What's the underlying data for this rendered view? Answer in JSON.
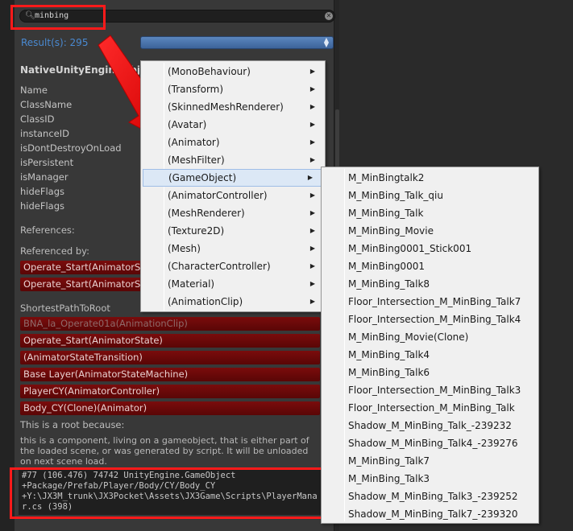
{
  "search": {
    "query": "minbing",
    "icon": "search-icon",
    "clear_icon": "clear-icon"
  },
  "results": {
    "label": "Result(s): 295"
  },
  "object": {
    "title": "NativeUnityEngineObje",
    "fields": [
      "Name",
      "ClassName",
      "ClassID",
      "instanceID",
      "isDontDestroyOnLoad",
      "isPersistent",
      "isManager",
      "hideFlags",
      "hideFlags"
    ]
  },
  "references": {
    "label": "References:"
  },
  "referenced_by": {
    "label": "Referenced by:",
    "rows": [
      "Operate_Start(AnimatorSt",
      "Operate_Start(AnimatorSt"
    ]
  },
  "shortest_path": {
    "label": "ShortestPathToRoot",
    "rows": [
      "BNA_la_Operate01a(AnimationClip)",
      "Operate_Start(AnimatorState)",
      "(AnimatorStateTransition)",
      "Base Layer(AnimatorStateMachine)",
      "PlayerCY(AnimatorController)",
      "Body_CY(Clone)(Animator)"
    ]
  },
  "root": {
    "label": "This is a root because:",
    "line1": "this is a component, living on a gameobject, that is either part of",
    "line2": "the loaded scene, or was generated by script. It will be unloaded",
    "line3": "on next scene load."
  },
  "stack": {
    "line1": "#77 (106.476) 74742 UnityEngine.GameObject",
    "line2": "+Package/Prefab/Player/Body/CY/Body_CY",
    "line3": "+Y:\\JX3M_trunk\\JX3Pocket\\Assets\\JX3Game\\Scripts\\PlayerMana",
    "line4": "r.cs (398)"
  },
  "type_menu": {
    "items": [
      "(MonoBehaviour)",
      "(Transform)",
      "(SkinnedMeshRenderer)",
      "(Avatar)",
      "(Animator)",
      "(MeshFilter)",
      "(GameObject)",
      "(AnimatorController)",
      "(MeshRenderer)",
      "(Texture2D)",
      "(Mesh)",
      "(CharacterController)",
      "(Material)",
      "(AnimationClip)"
    ],
    "highlighted_index": 6
  },
  "gameobject_menu": {
    "items": [
      "M_MinBingtalk2",
      "M_MinBing_Talk_qiu",
      "M_MinBing_Talk",
      "M_MinBing_Movie",
      "M_MinBing0001_Stick001",
      "M_MinBing0001",
      "M_MinBing_Talk8",
      "Floor_Intersection_M_MinBing_Talk7",
      "Floor_Intersection_M_MinBing_Talk4",
      "M_MinBing_Movie(Clone)",
      "M_MinBing_Talk4",
      "M_MinBing_Talk6",
      "Floor_Intersection_M_MinBing_Talk3",
      "Floor_Intersection_M_MinBing_Talk",
      "Shadow_M_MinBing_Talk_-239232",
      "Shadow_M_MinBing_Talk4_-239276",
      "M_MinBing_Talk7",
      "M_MinBing_Talk3",
      "Shadow_M_MinBing_Talk3_-239252",
      "Shadow_M_MinBing_Talk7_-239320"
    ]
  },
  "colors": {
    "accent_blue": "#4a8ad2",
    "annotation_red": "#ff1a1a",
    "ref_row": "#6a0a0a",
    "menu_bg": "#f0f0f0"
  }
}
